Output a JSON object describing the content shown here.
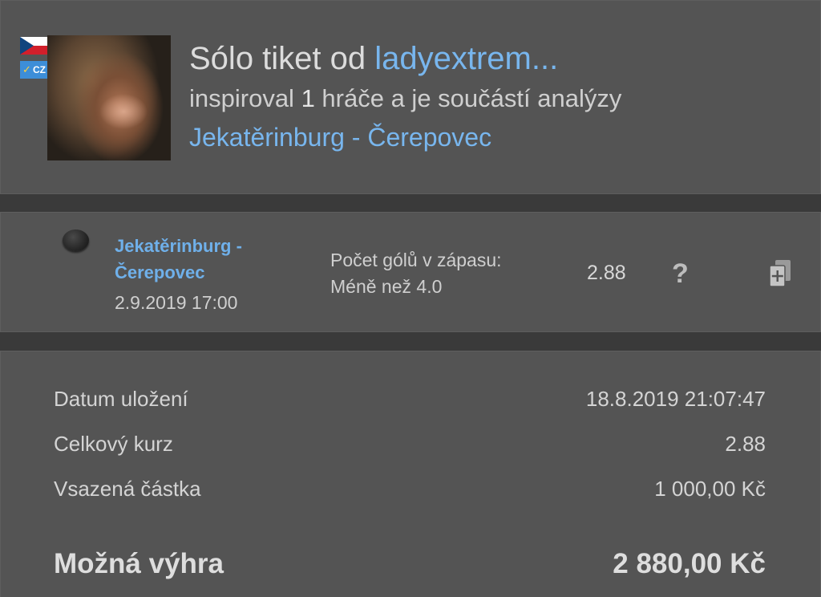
{
  "header": {
    "title_prefix": "Sólo tiket od ",
    "username": "ladyextrem...",
    "subtitle_pre": "inspiroval ",
    "inspired_count": "1",
    "subtitle_post": " hráče a je součástí analýzy",
    "analysis_match": "Jekatěrinburg - Čerepovec",
    "lang_badge": "CZ",
    "flag_icon": "czech-flag-icon"
  },
  "bet": {
    "status_icon": "pending-dot-icon",
    "match_line1": "Jekatěrinburg -",
    "match_line2": "Čerepovec",
    "datetime": "2.9.2019 17:00",
    "market": "Počet gólů v zápasu:",
    "selection": "Méně než 4.0",
    "odds": "2.88",
    "help_label": "?",
    "copy_icon": "copy-add-icon"
  },
  "summary": {
    "saved_label": "Datum uložení",
    "saved_value": "18.8.2019 21:07:47",
    "total_odds_label": "Celkový kurz",
    "total_odds_value": "2.88",
    "stake_label": "Vsazená částka",
    "stake_value": "1 000,00 Kč",
    "win_label": "Možná výhra",
    "win_value": "2 880,00 Kč"
  },
  "colors": {
    "background": "#3a3a3a",
    "panel": "#545454",
    "link": "#78b6ee",
    "text": "#d4d4d4"
  }
}
